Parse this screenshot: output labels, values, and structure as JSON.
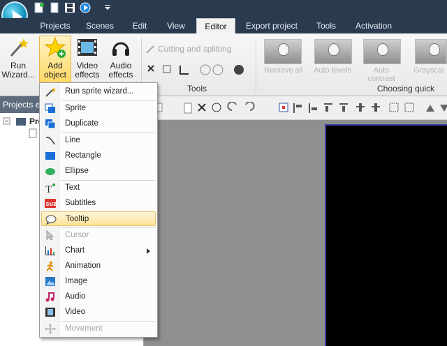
{
  "tabs": [
    {
      "label": "Projects"
    },
    {
      "label": "Scenes"
    },
    {
      "label": "Edit"
    },
    {
      "label": "View"
    },
    {
      "label": "Editor"
    },
    {
      "label": "Export project"
    },
    {
      "label": "Tools"
    },
    {
      "label": "Activation"
    }
  ],
  "active_tab": "Editor",
  "ribbon": {
    "run_wizard": "Run Wizard...",
    "add_object": "Add object",
    "video_effects": "Video effects",
    "audio_effects": "Audio effects",
    "cutting_and_splitting": "Cutting and splitting",
    "tools_group": "Tools",
    "quick_style_group": "Choosing quick sty",
    "thumbs": [
      {
        "label": "Remove all"
      },
      {
        "label": "Auto levels"
      },
      {
        "label": "Auto contrast"
      },
      {
        "label": "Grayscal"
      }
    ]
  },
  "left_panel": {
    "title": "Projects ex",
    "tree_item": "Pro"
  },
  "menu": {
    "items": [
      {
        "label": "Run sprite wizard...",
        "icon": "magic-wand-icon"
      },
      {
        "label": "Sprite",
        "icon": "sprite-icon"
      },
      {
        "label": "Duplicate",
        "icon": "duplicate-icon"
      },
      {
        "label": "Line",
        "icon": "line-icon"
      },
      {
        "label": "Rectangle",
        "icon": "rectangle-icon"
      },
      {
        "label": "Ellipse",
        "icon": "ellipse-icon"
      },
      {
        "label": "Text",
        "icon": "text-icon"
      },
      {
        "label": "Subtitles",
        "icon": "subtitles-icon"
      },
      {
        "label": "Tooltip",
        "icon": "tooltip-icon"
      },
      {
        "label": "Cursor",
        "icon": "cursor-icon"
      },
      {
        "label": "Chart",
        "icon": "chart-icon"
      },
      {
        "label": "Animation",
        "icon": "animation-icon"
      },
      {
        "label": "Image",
        "icon": "image-icon"
      },
      {
        "label": "Audio",
        "icon": "audio-icon"
      },
      {
        "label": "Video",
        "icon": "video-icon"
      },
      {
        "label": "Movement",
        "icon": "movement-icon"
      }
    ],
    "subtitles_badge": "SUB",
    "hovered": "Tooltip"
  },
  "colors": {
    "titlebar": "#2a3a4f",
    "hover": "#ffe39a",
    "canvas": "#000000"
  }
}
